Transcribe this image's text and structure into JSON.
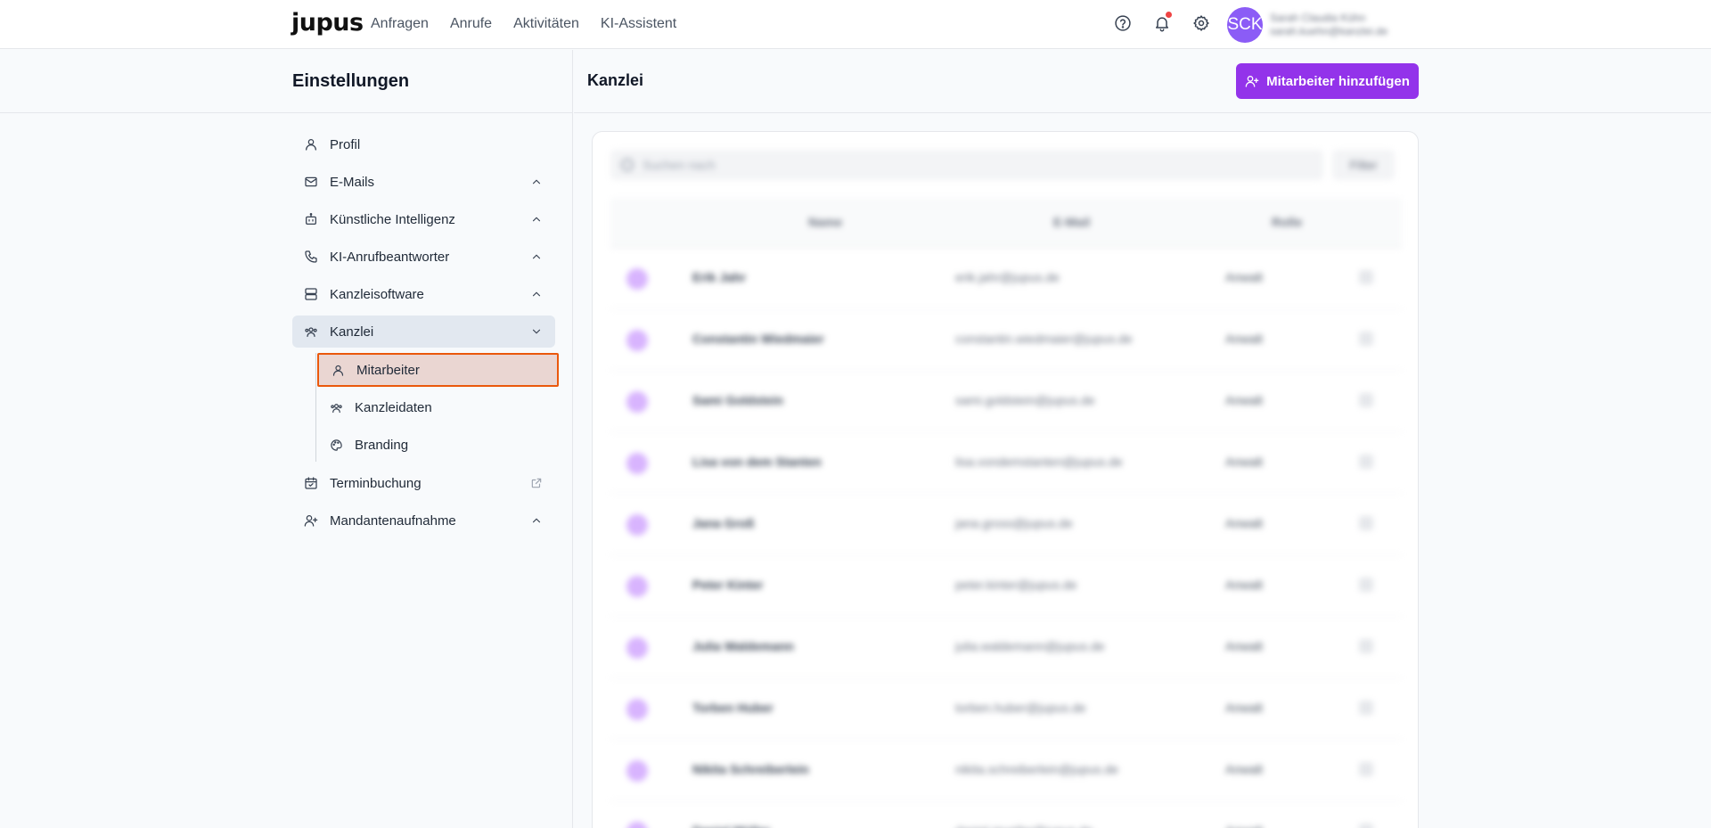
{
  "header": {
    "logo": "jupus",
    "nav": [
      "Anfragen",
      "Anrufe",
      "Aktivitäten",
      "KI-Assistent"
    ],
    "avatar_initials": "SCK",
    "user_line1": "Sarah Claudia Kühn",
    "user_line2": "sarah.kuehn@kanzlei.de"
  },
  "sidebar": {
    "title": "Einstellungen",
    "items": [
      {
        "label": "Profil",
        "icon": "user-icon"
      },
      {
        "label": "E-Mails",
        "icon": "mail-icon"
      },
      {
        "label": "Künstliche Intelligenz",
        "icon": "bot-icon"
      },
      {
        "label": "KI-Anrufbeantworter",
        "icon": "phone-icon"
      },
      {
        "label": "Kanzleisoftware",
        "icon": "server-icon"
      },
      {
        "label": "Kanzlei",
        "icon": "team-icon"
      },
      {
        "label": "Terminbuchung",
        "icon": "calendar-icon"
      },
      {
        "label": "Mandantenaufnahme",
        "icon": "user-plus-icon"
      }
    ],
    "subitems": [
      {
        "label": "Mitarbeiter",
        "icon": "user-icon"
      },
      {
        "label": "Kanzleidaten",
        "icon": "team-icon"
      },
      {
        "label": "Branding",
        "icon": "palette-icon"
      }
    ]
  },
  "main": {
    "title": "Kanzlei",
    "add_button": "Mitarbeiter hinzufügen",
    "search_placeholder": "Suchen nach",
    "filter_label": "Filter",
    "columns": [
      "Name",
      "E-Mail",
      "Rolle"
    ],
    "rows": [
      {
        "name": "Erik Jahr",
        "email": "erik.jahr@jupus.de",
        "role": "Anwalt"
      },
      {
        "name": "Constantin Wiedmaier",
        "email": "constantin.wiedmaier@jupus.de",
        "role": "Anwalt"
      },
      {
        "name": "Sami Goldstein",
        "email": "sami.goldstein@jupus.de",
        "role": "Anwalt"
      },
      {
        "name": "Lisa von dem Stanten",
        "email": "lisa.vondemstanten@jupus.de",
        "role": "Anwalt"
      },
      {
        "name": "Jana Groß",
        "email": "jana.gross@jupus.de",
        "role": "Anwalt"
      },
      {
        "name": "Peter Kinter",
        "email": "peter.kinter@jupus.de",
        "role": "Anwalt"
      },
      {
        "name": "Julia Waldemann",
        "email": "julia.waldemann@jupus.de",
        "role": "Anwalt"
      },
      {
        "name": "Torben Huber",
        "email": "torben.huber@jupus.de",
        "role": "Anwalt"
      },
      {
        "name": "Nikita Schreiberlein",
        "email": "nikita.schreiberlein@jupus.de",
        "role": "Anwalt"
      },
      {
        "name": "Daniel Müller",
        "email": "daniel.mueller@jupus.de",
        "role": "Anwalt"
      }
    ]
  },
  "colors": {
    "accent": "#9333ea",
    "selected_border": "#ea580c",
    "active_bg": "#e2e8f0"
  }
}
